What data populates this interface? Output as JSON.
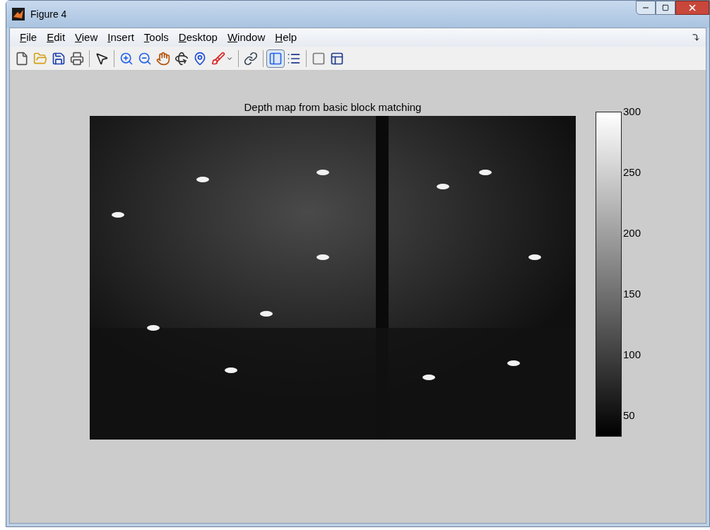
{
  "window": {
    "title": "Figure 4"
  },
  "menu": [
    {
      "label": "File"
    },
    {
      "label": "Edit"
    },
    {
      "label": "View"
    },
    {
      "label": "Insert"
    },
    {
      "label": "Tools"
    },
    {
      "label": "Desktop"
    },
    {
      "label": "Window"
    },
    {
      "label": "Help"
    }
  ],
  "toolbar": {
    "groups": [
      [
        {
          "kind": "button",
          "selected": false
        },
        {
          "kind": "button",
          "selected": false
        },
        {
          "kind": "button",
          "selected": false
        },
        {
          "kind": "button",
          "selected": false
        }
      ],
      [
        {
          "kind": "button",
          "selected": false
        }
      ],
      [
        {
          "kind": "button",
          "selected": false
        },
        {
          "kind": "button",
          "selected": false
        },
        {
          "kind": "button",
          "selected": false
        },
        {
          "kind": "button",
          "selected": false
        },
        {
          "kind": "button",
          "selected": false
        },
        {
          "kind": "dropdown",
          "selected": false
        }
      ],
      [
        {
          "kind": "button",
          "selected": false
        }
      ],
      [
        {
          "kind": "button",
          "selected": true
        },
        {
          "kind": "button",
          "selected": false
        }
      ],
      [
        {
          "kind": "button",
          "selected": false
        },
        {
          "kind": "button",
          "selected": false
        }
      ]
    ]
  },
  "figure": {
    "title": "Depth map from basic block matching",
    "colorbar": {
      "ticks": [
        "300",
        "250",
        "200",
        "150",
        "100",
        "50"
      ]
    }
  }
}
